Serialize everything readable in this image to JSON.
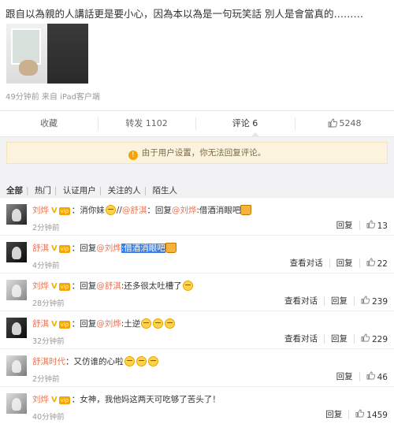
{
  "post": {
    "text": "跟自以為親的人講話更是要小心，因為本以為是一句玩笑話 別人是會當真的………",
    "time": "49分钟前",
    "source": "来自 iPad客户端"
  },
  "actions": {
    "collect": "收藏",
    "repost": "转发 1102",
    "comment": "评论 6",
    "likes": "5248"
  },
  "notice": "由于用户设置，你无法回复评论。",
  "filters": [
    "全部",
    "热门",
    "认证用户",
    "关注的人",
    "陌生人"
  ],
  "labels": {
    "reply": "回复",
    "view_conversation": "查看对话",
    "vip": "vip"
  },
  "comments": [
    {
      "user": "刘烨",
      "segments": [
        {
          "text": "：消你妹"
        },
        {
          "emoji": "cry-face"
        },
        {
          "text": "//"
        },
        {
          "text": "@舒淇",
          "link": true
        },
        {
          "text": "：回复"
        },
        {
          "text": "@刘烨",
          "link": true
        },
        {
          "text": ":借酒消眼吧"
        },
        {
          "emoji": "beer"
        }
      ],
      "time": "2分钟前",
      "show_view": false,
      "likes": "13"
    },
    {
      "user": "舒淇",
      "segments": [
        {
          "text": "：回复"
        },
        {
          "text": "@刘烨",
          "link": true
        },
        {
          "text": ":借酒消眼吧",
          "highlight": true
        },
        {
          "emoji": "beer"
        }
      ],
      "time": "4分钟前",
      "show_view": true,
      "likes": "22"
    },
    {
      "user": "刘烨",
      "segments": [
        {
          "text": "：回复"
        },
        {
          "text": "@舒淇",
          "link": true
        },
        {
          "text": ":还多很太吐槽了"
        },
        {
          "emoji": "cry-face"
        }
      ],
      "time": "28分钟前",
      "show_view": true,
      "likes": "239"
    },
    {
      "user": "舒淇",
      "segments": [
        {
          "text": "：回复"
        },
        {
          "text": "@刘烨",
          "link": true
        },
        {
          "text": ":土逆"
        },
        {
          "emoji": "cry-face"
        },
        {
          "emoji": "cry-face"
        },
        {
          "emoji": "cry-face"
        }
      ],
      "time": "32分钟前",
      "show_view": true,
      "likes": "229"
    },
    {
      "user": "舒淇时代",
      "segments": [
        {
          "text": "：又仿谁的心啦"
        },
        {
          "emoji": "cry-face"
        },
        {
          "emoji": "cry-face"
        },
        {
          "emoji": "cry-face"
        }
      ],
      "time": "2分钟前",
      "show_view": false,
      "likes": "46"
    },
    {
      "user": "刘烨",
      "segments": [
        {
          "text": "：女神，我他妈这两天可吃够了苦头了！"
        }
      ],
      "time": "40分钟前",
      "show_view": false,
      "likes": "1459"
    }
  ]
}
